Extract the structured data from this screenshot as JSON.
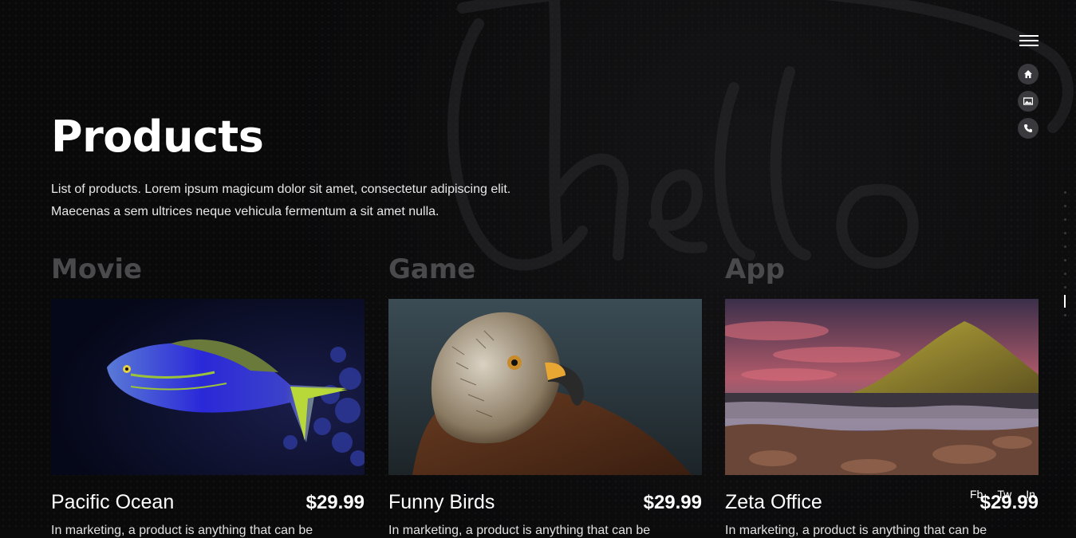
{
  "header": {
    "title": "Products",
    "intro": "List of products. Lorem ipsum magicum dolor sit amet, consectetur adipiscing elit. Maecenas a sem ultrices neque vehicula fermentum a sit amet nulla."
  },
  "nav": {
    "menu_icon": "hamburger-icon",
    "items": [
      {
        "icon": "home-icon"
      },
      {
        "icon": "gallery-icon"
      },
      {
        "icon": "phone-icon"
      }
    ]
  },
  "categories": [
    {
      "label": "Movie",
      "product": {
        "name": "Pacific Ocean",
        "price": "$29.99",
        "image": "fish",
        "desc": "In marketing, a product is anything that can be"
      }
    },
    {
      "label": "Game",
      "product": {
        "name": "Funny Birds",
        "price": "$29.99",
        "image": "eagle",
        "desc": "In marketing, a product is anything that can be"
      }
    },
    {
      "label": "App",
      "product": {
        "name": "Zeta Office",
        "price": "$29.99",
        "image": "mountain",
        "desc": "In marketing, a product is anything that can be"
      }
    }
  ],
  "social": [
    "Fb",
    "Tw",
    "In"
  ],
  "colors": {
    "background": "#0a0a0b",
    "category": "#4a4a4d",
    "nav_dot": "#3a3a3e"
  }
}
